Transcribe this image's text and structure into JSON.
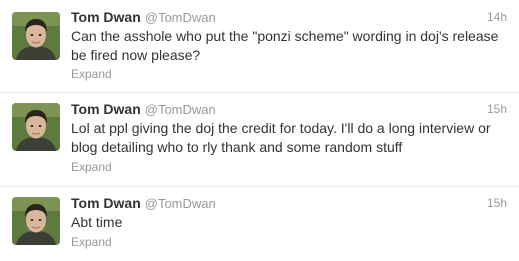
{
  "colors": {
    "name": "#333333",
    "meta": "#999999",
    "divider": "#e8e8e8",
    "avatar_bg": "#5f7a3e",
    "avatar_skin": "#d9b79c",
    "avatar_hair": "#2a241e"
  },
  "tweets": [
    {
      "fullname": "Tom Dwan",
      "username": "@TomDwan",
      "time": "14h",
      "text": "Can the asshole who put the \"ponzi scheme\" wording in doj's release be fired now please?",
      "expand": "Expand",
      "avatar_icon": "profile-photo"
    },
    {
      "fullname": "Tom Dwan",
      "username": "@TomDwan",
      "time": "15h",
      "text": "Lol at ppl giving the doj the credit for today. I'll do a long interview or blog detailing who to rly thank and some random stuff",
      "expand": "Expand",
      "avatar_icon": "profile-photo"
    },
    {
      "fullname": "Tom Dwan",
      "username": "@TomDwan",
      "time": "15h",
      "text": "Abt time",
      "expand": "Expand",
      "avatar_icon": "profile-photo"
    }
  ]
}
